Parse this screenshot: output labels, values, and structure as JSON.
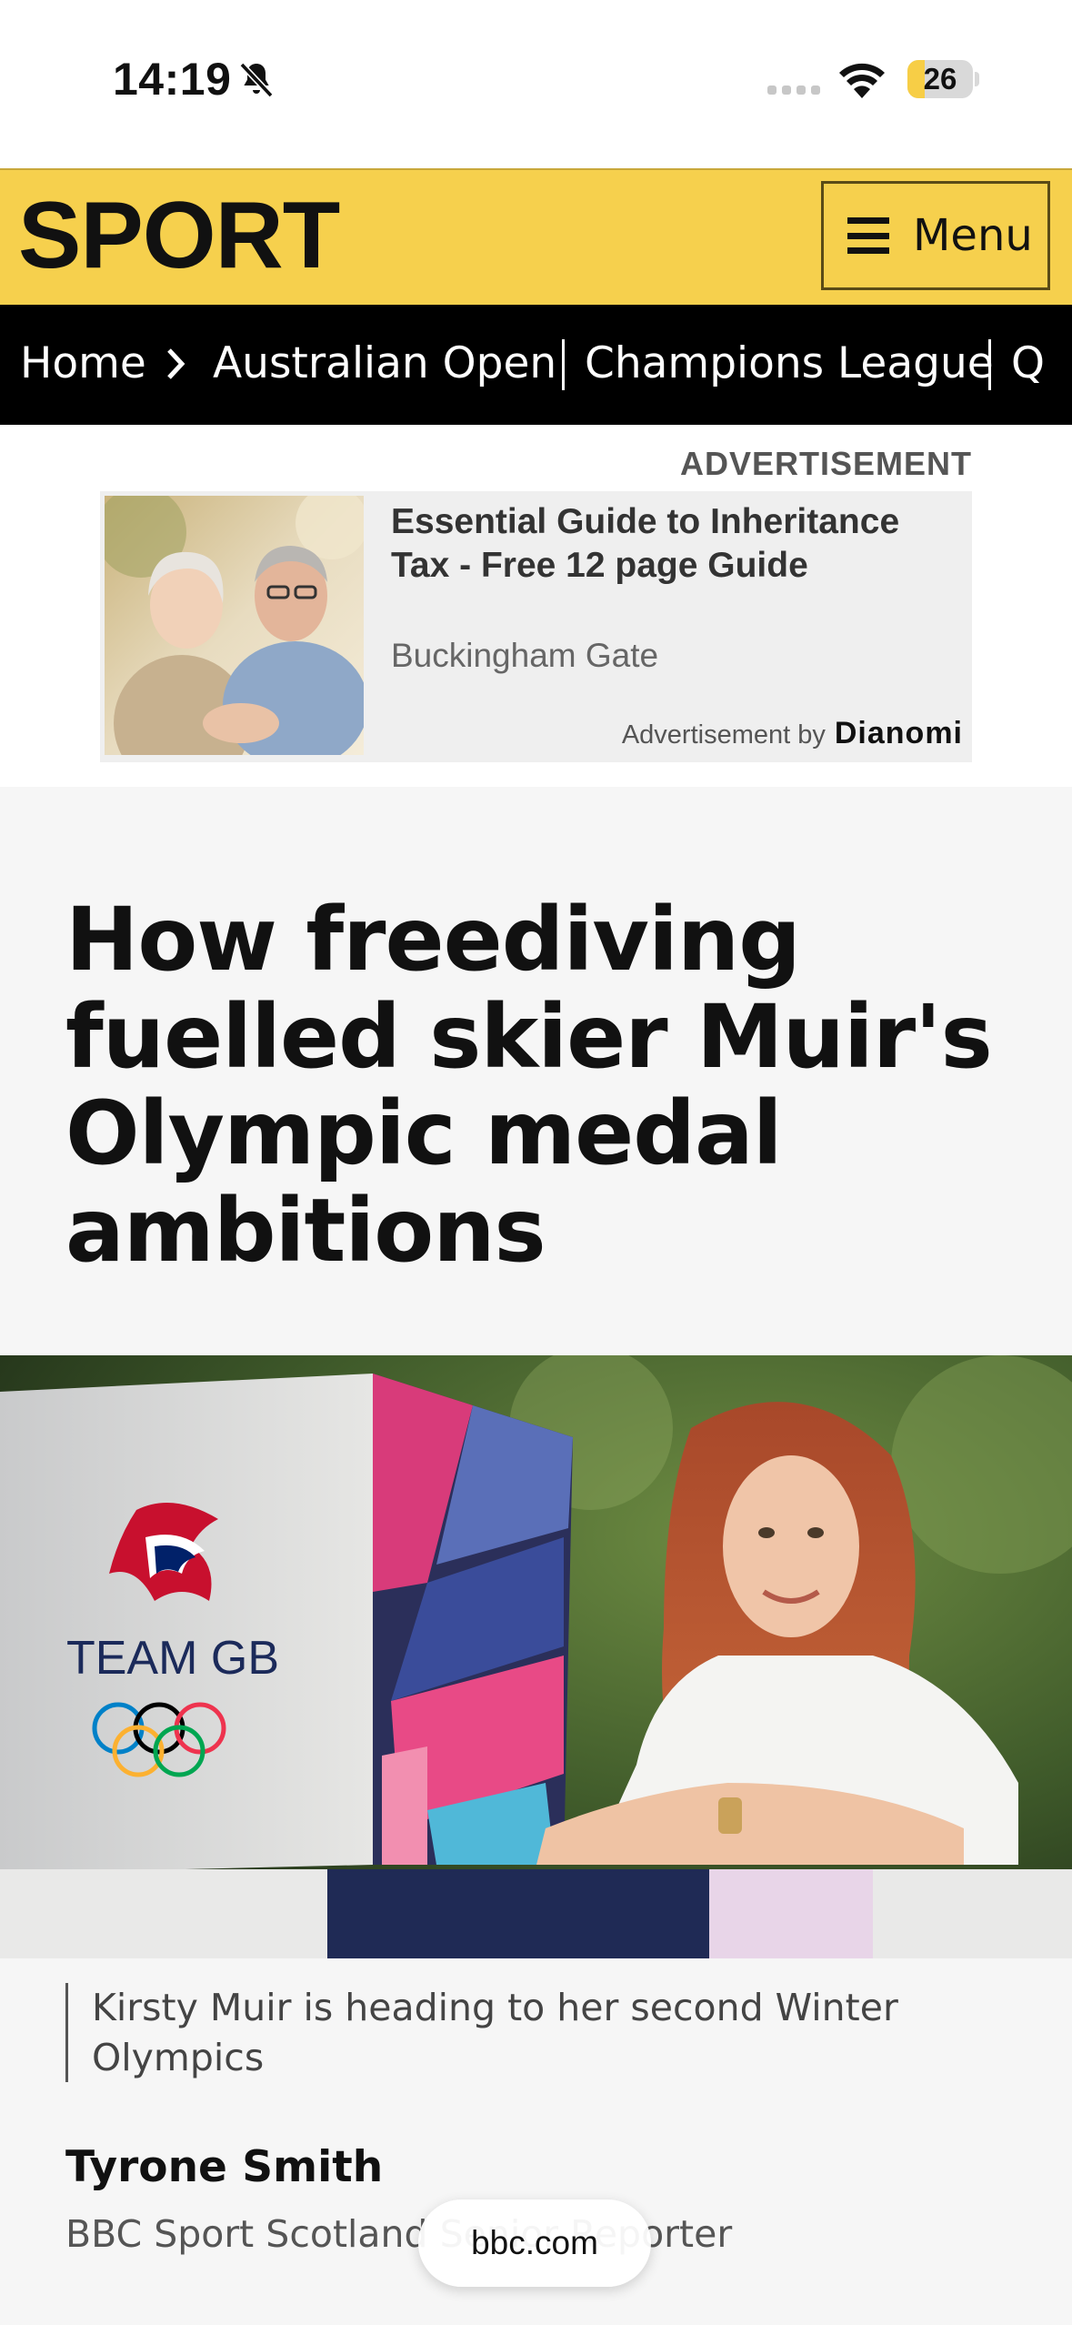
{
  "status_bar": {
    "time": "14:19",
    "battery": "26",
    "battery_level": 0.26,
    "icons": [
      "bell-slash-icon",
      "cellular-signal-icon",
      "wifi-icon",
      "battery-icon"
    ]
  },
  "header": {
    "logo": "SPORT",
    "menu_label": "Menu",
    "background": "#f6d04d"
  },
  "nav": {
    "items": [
      {
        "label": "Home"
      },
      {
        "label": "Australian Open"
      },
      {
        "label": "Champions League"
      },
      {
        "label": "Q"
      }
    ]
  },
  "ad": {
    "label": "ADVERTISEMENT",
    "headline": "Essential Guide to Inheritance Tax - Free 12 page Guide",
    "advertiser": "Buckingham Gate",
    "by_text": "Advertisement by",
    "brand": "Dianomi"
  },
  "article": {
    "headline": "How freediving fuelled skier Muir's Olympic medal ambitions",
    "hero_box_text": "TEAM GB",
    "caption": "Kirsty Muir is heading to her second Winter Olympics",
    "author": "Tyrone Smith",
    "author_role": "BBC Sport Scotland Senior Reporter"
  },
  "browser": {
    "url": "bbc.com"
  }
}
